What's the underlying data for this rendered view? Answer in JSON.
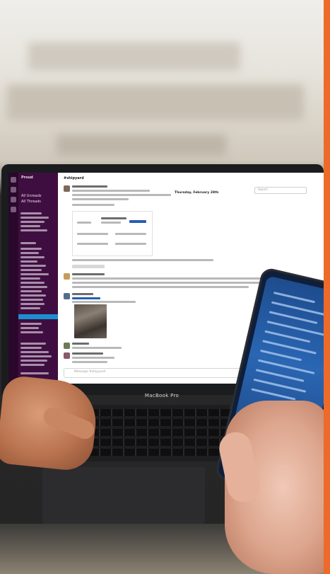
{
  "photo": {
    "description_colors": {
      "accent": "#ee6a2a",
      "sidebar": "#3f0e40",
      "active_channel": "#1d8fd1"
    }
  },
  "screen": {
    "channel": "#shipyard",
    "date_divider": "Thursday, February 28th",
    "search_placeholder": "Search",
    "composer_placeholder": "Message #shipyard"
  },
  "sidebar": {
    "workspace": "Proud",
    "items": [
      "All Unreads",
      "All Threads"
    ]
  },
  "device_label": "MacBook Pro"
}
